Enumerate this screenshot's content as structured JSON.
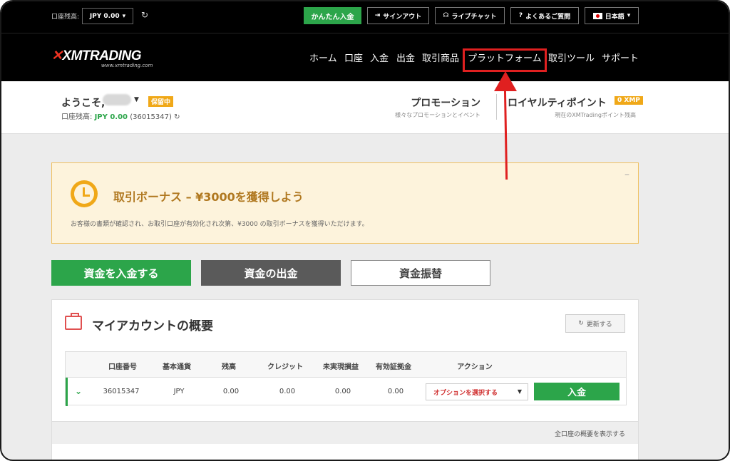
{
  "topbar": {
    "balance_label": "口座残高:",
    "balance_dropdown": "JPY 0.00",
    "easy_deposit": "かんたん入金",
    "sign_out": "サインアウト",
    "live_chat": "ライブチャット",
    "faq": "よくあるご質問",
    "language": "日本語"
  },
  "nav": {
    "logo": "XMTRADING",
    "logo_sub": "www.xmtrading.com",
    "items": [
      "ホーム",
      "口座",
      "入金",
      "出金",
      "取引商品",
      "プラットフォーム",
      "取引ツール",
      "サポート"
    ]
  },
  "user": {
    "welcome": "ようこそ,",
    "status_badge": "保留中",
    "account_balance_label": "口座残高:",
    "account_balance_value": "JPY 0.00",
    "account_id": "(36015347)"
  },
  "promotion": {
    "title": "プロモーション",
    "subtitle": "様々なプロモーションとイベント"
  },
  "loyalty": {
    "title": "ロイヤルティポイント",
    "badge": "0 XMP",
    "subtitle": "現在のXMTradingポイント残高"
  },
  "bonus": {
    "title": "取引ボーナス – ¥3000を獲得しよう",
    "text": "お客様の書類が確認され、お取引口座が有効化され次第、¥3000 の取引ボーナスを獲得いただけます。",
    "collapse": "–"
  },
  "actions": {
    "deposit": "資金を入金する",
    "withdraw": "資金の出金",
    "transfer": "資金振替"
  },
  "overview": {
    "title": "マイアカウントの概要",
    "refresh": "更新する",
    "columns": [
      "口座番号",
      "基本通貨",
      "残高",
      "クレジット",
      "未実現損益",
      "有効証拠金",
      "アクション"
    ],
    "row": {
      "account": "36015347",
      "currency": "JPY",
      "balance": "0.00",
      "credit": "0.00",
      "unrealized": "0.00",
      "equity": "0.00",
      "select_option": "オプションを選択する",
      "deposit": "入金"
    },
    "footer_link": "全口座の概要を表示する"
  },
  "colors": {
    "brand_green": "#2ca54a",
    "highlight_red": "#e02020",
    "badge_orange": "#f0a818"
  }
}
